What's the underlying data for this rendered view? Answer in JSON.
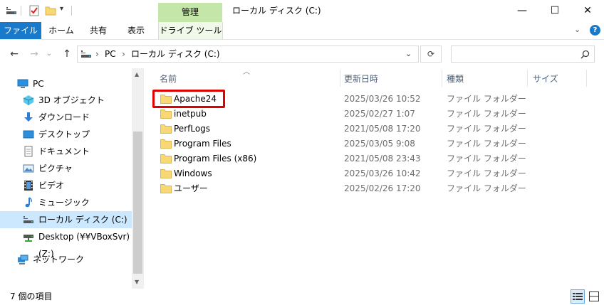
{
  "window": {
    "context_tab": "管理",
    "title": "ローカル ディスク (C:)",
    "minimize": "—",
    "maximize": "☐",
    "close": "✕"
  },
  "ribbon": {
    "tabs": [
      "ファイル",
      "ホーム",
      "共有",
      "表示",
      "ドライブ ツール"
    ]
  },
  "address": {
    "crumbs": [
      "PC",
      "ローカル ディスク (C:)"
    ],
    "search_placeholder": ""
  },
  "nav": {
    "items": [
      {
        "label": "PC",
        "icon": "pc-icon"
      },
      {
        "label": "3D オブジェクト",
        "icon": "3d-objects-icon"
      },
      {
        "label": "ダウンロード",
        "icon": "download-icon"
      },
      {
        "label": "デスクトップ",
        "icon": "desktop-icon"
      },
      {
        "label": "ドキュメント",
        "icon": "document-icon"
      },
      {
        "label": "ピクチャ",
        "icon": "pictures-icon"
      },
      {
        "label": "ビデオ",
        "icon": "video-icon"
      },
      {
        "label": "ミュージック",
        "icon": "music-icon"
      },
      {
        "label": "ローカル ディスク (C:)",
        "icon": "drive-icon"
      },
      {
        "label": "Desktop (¥¥VBoxSvr) (Z:)",
        "icon": "network-drive-icon"
      },
      {
        "label": "ネットワーク",
        "icon": "network-icon"
      }
    ]
  },
  "columns": {
    "name": "名前",
    "date": "更新日時",
    "type": "種類",
    "size": "サイズ"
  },
  "files": [
    {
      "name": "Apache24",
      "date": "2025/03/26 10:52",
      "type": "ファイル フォルダー"
    },
    {
      "name": "inetpub",
      "date": "2025/02/27 1:07",
      "type": "ファイル フォルダー"
    },
    {
      "name": "PerfLogs",
      "date": "2021/05/08 17:20",
      "type": "ファイル フォルダー"
    },
    {
      "name": "Program Files",
      "date": "2025/03/05 9:08",
      "type": "ファイル フォルダー"
    },
    {
      "name": "Program Files (x86)",
      "date": "2021/05/08 23:43",
      "type": "ファイル フォルダー"
    },
    {
      "name": "Windows",
      "date": "2025/03/26 10:42",
      "type": "ファイル フォルダー"
    },
    {
      "name": "ユーザー",
      "date": "2025/02/26 17:20",
      "type": "ファイル フォルダー"
    }
  ],
  "status": {
    "count_text": "7 個の項目"
  },
  "colors": {
    "accent": "#1979ca",
    "context_tab": "#c5e6a9",
    "selection": "#cce8ff",
    "highlight": "#e00000",
    "folder": "#f8d775"
  }
}
